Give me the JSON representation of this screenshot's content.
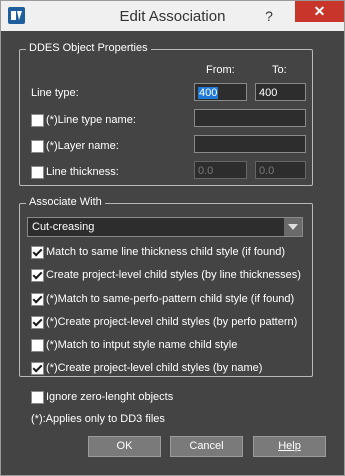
{
  "window": {
    "title": "Edit Association",
    "help_glyph": "?",
    "close_glyph": "✕",
    "icon": "app-logo-icon"
  },
  "ddes": {
    "group_title": "DDES Object Properties",
    "from_header": "From:",
    "to_header": "To:",
    "line_type_label": "Line type:",
    "line_type_from": "400",
    "line_type_to": "400",
    "line_type_name_label": "(*)Line type name:",
    "line_type_name_checked": false,
    "line_type_name_value": "",
    "layer_name_label": "(*)Layer name:",
    "layer_name_checked": false,
    "layer_name_value": "",
    "line_thickness_label": "Line thickness:",
    "line_thickness_checked": false,
    "line_thickness_from": "0.0",
    "line_thickness_to": "0.0"
  },
  "associate": {
    "group_title": "Associate With",
    "selected": "Cut-creasing",
    "options": [
      {
        "label": "Match to same line thickness child style (if found)",
        "checked": true
      },
      {
        "label": "Create project-level child styles (by line thicknesses)",
        "checked": true
      },
      {
        "label": "(*)Match to same-perfo-pattern child style (if found)",
        "checked": true
      },
      {
        "label": "(*)Create project-level child styles (by perfo pattern)",
        "checked": true
      },
      {
        "label": "(*)Match to intput style name child style",
        "checked": false
      },
      {
        "label": "(*)Create project-level child styles (by name)",
        "checked": true
      }
    ]
  },
  "ignore_zero": {
    "label": "Ignore zero-lenght objects",
    "checked": false
  },
  "footnote": "(*):Applies only to DD3 files",
  "buttons": {
    "ok": "OK",
    "cancel": "Cancel",
    "help": "Help"
  }
}
